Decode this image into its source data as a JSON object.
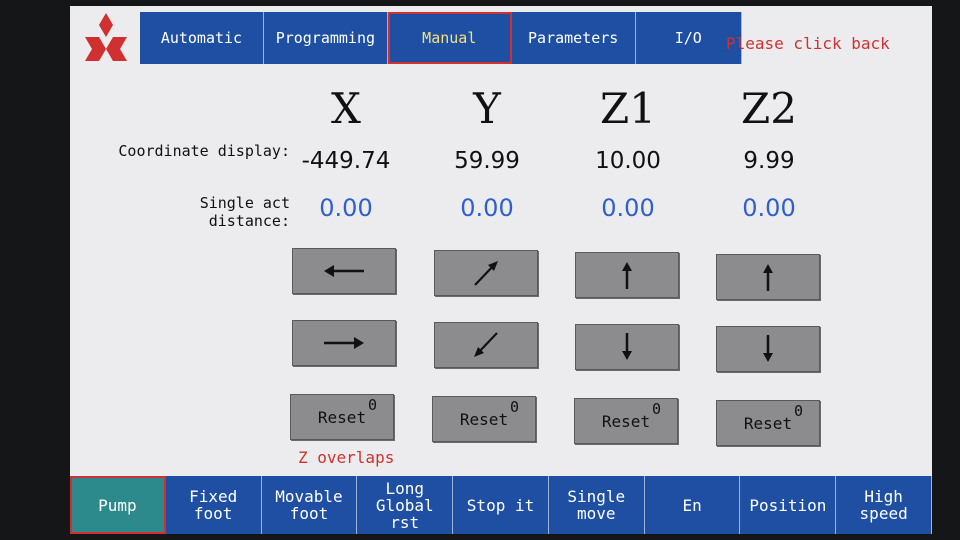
{
  "tabs": [
    {
      "label": "Automatic"
    },
    {
      "label": "Programming"
    },
    {
      "label": "Manual"
    },
    {
      "label": "Parameters"
    },
    {
      "label": "I/O"
    }
  ],
  "hint": "Please click back",
  "axes": [
    {
      "name": "X",
      "coordinate": "-449.74",
      "distance": "0.00",
      "reset_label": "Reset",
      "reset_count": "0"
    },
    {
      "name": "Y",
      "coordinate": "59.99",
      "distance": "0.00",
      "reset_label": "Reset",
      "reset_count": "0"
    },
    {
      "name": "Z1",
      "coordinate": "10.00",
      "distance": "0.00",
      "reset_label": "Reset",
      "reset_count": "0"
    },
    {
      "name": "Z2",
      "coordinate": "9.99",
      "distance": "0.00",
      "reset_label": "Reset",
      "reset_count": "0"
    }
  ],
  "labels": {
    "coordinate_display": "Coordinate display:",
    "single_act_distance": "Single act distance:"
  },
  "z_overlaps": "Z overlaps",
  "bottom_buttons": [
    {
      "label": "Pump"
    },
    {
      "label": "Fixed foot"
    },
    {
      "label": "Movable\nfoot"
    },
    {
      "label": "Long\nGlobal rst"
    },
    {
      "label": "Stop it"
    },
    {
      "label": "Single\nmove"
    },
    {
      "label": "En"
    },
    {
      "label": "Position"
    },
    {
      "label": "High\nspeed"
    }
  ],
  "colors": {
    "bar_blue": "#1f4fa3",
    "warning_red": "#d0302f",
    "value_blue": "#2f5fcf",
    "pump_active": "#2d8a8c",
    "button_gray": "#8c8c8e"
  },
  "icons": {
    "x_buttons": [
      "arrow-left-icon",
      "arrow-right-icon"
    ],
    "y_buttons": [
      "arrow-up-right-icon",
      "arrow-down-left-icon"
    ],
    "z1_buttons": [
      "arrow-up-icon",
      "arrow-down-icon"
    ],
    "z2_buttons": [
      "arrow-up-icon",
      "arrow-down-icon"
    ]
  }
}
